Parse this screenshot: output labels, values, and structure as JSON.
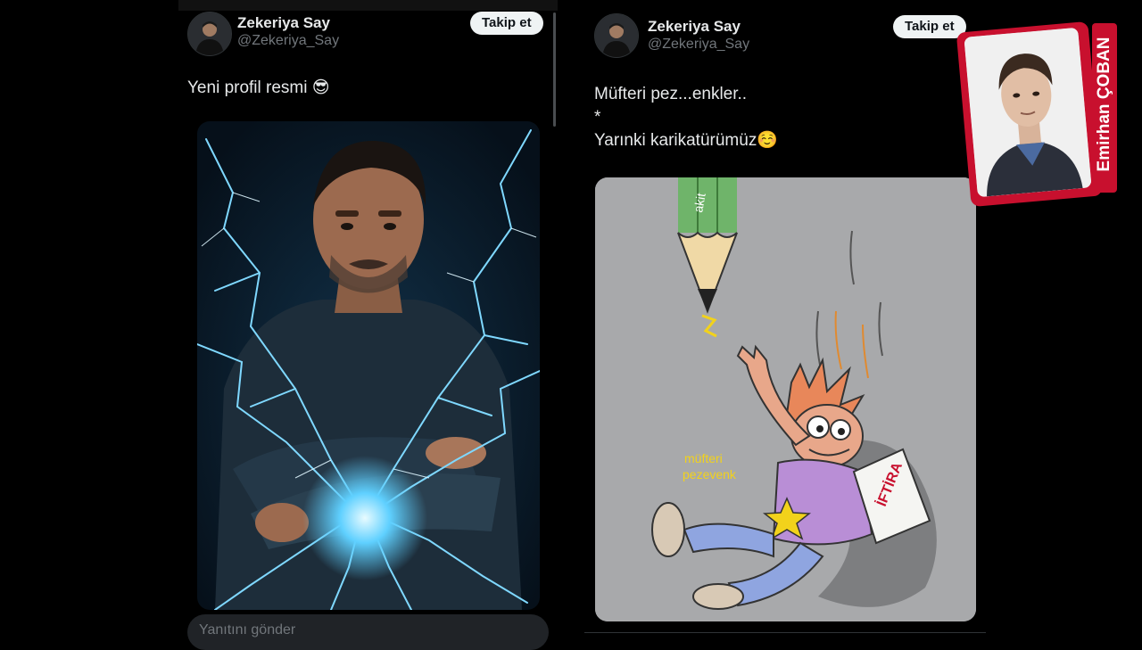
{
  "left_tweet": {
    "author_name": "Zekeriya Say",
    "author_handle": "@Zekeriya_Say",
    "follow_label": "Takip et",
    "text": "Yeni profil resmi 😎",
    "reply_placeholder": "Yanıtını gönder",
    "avatar_icon": "profile-photo",
    "media_icon": "lightning-portrait-image"
  },
  "right_tweet": {
    "author_name": "Zekeriya Say",
    "author_handle": "@Zekeriya_Say",
    "follow_label": "Takip et",
    "text_line1": "Müfteri pez...enkler..",
    "text_line2": "*",
    "text_line3": "Yarınki karikatürümüz☺️",
    "avatar_icon": "profile-photo",
    "cartoon": {
      "pencil_label": "akit",
      "label_left": "müfteri\npezevenk",
      "label_paper": "İFTİRA"
    }
  },
  "inset": {
    "name": "Emirhan ÇOBAN",
    "accent_color": "#c8102e"
  },
  "colors": {
    "background": "#000000",
    "text_primary": "#e7e9ea",
    "text_secondary": "#71767b",
    "follow_bg": "#eff3f4"
  }
}
